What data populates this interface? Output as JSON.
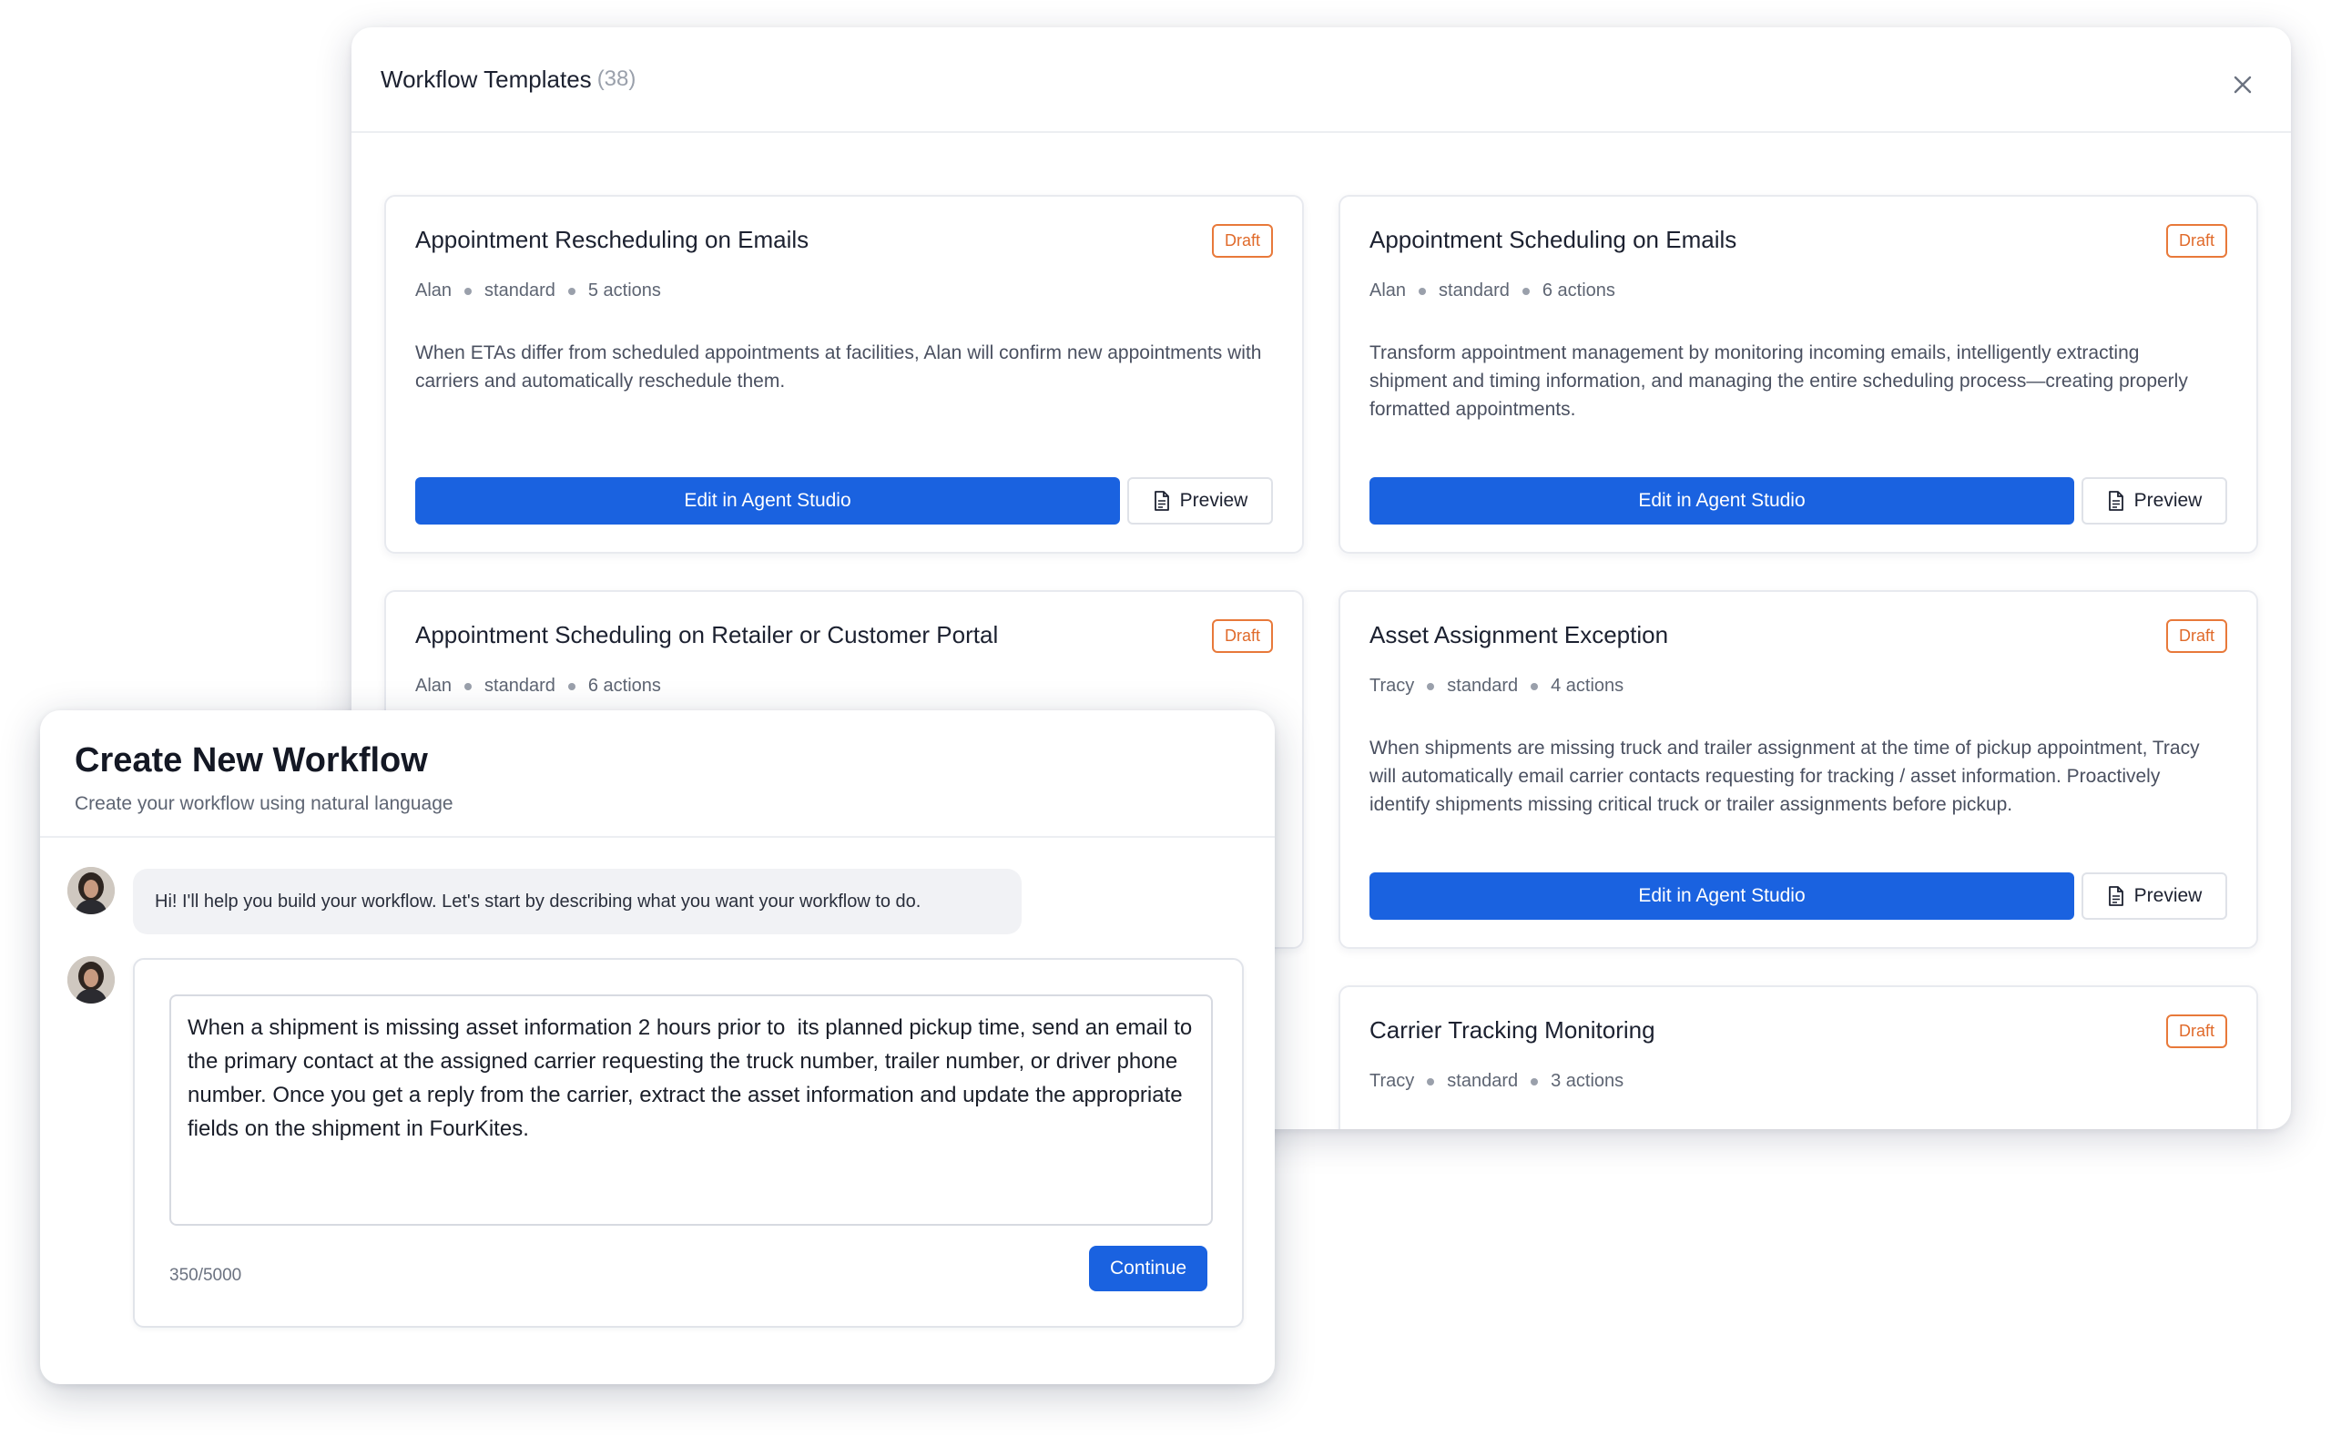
{
  "templates": {
    "title": "Workflow Templates",
    "count": "(38)",
    "cards": [
      {
        "title": "Appointment Rescheduling on Emails",
        "status": "Draft",
        "agent": "Alan",
        "type": "standard",
        "actions": "5 actions",
        "description": "When ETAs differ from scheduled appointments at facilities, Alan will confirm new appointments with carriers and automatically reschedule them.",
        "edit_label": "Edit in Agent Studio",
        "preview_label": "Preview"
      },
      {
        "title": "Appointment Scheduling on Emails",
        "status": "Draft",
        "agent": "Alan",
        "type": "standard",
        "actions": "6 actions",
        "description": "Transform appointment management by monitoring incoming emails, intelligently extracting shipment and timing information, and managing the entire scheduling process—creating properly formatted appointments.",
        "edit_label": "Edit in Agent Studio",
        "preview_label": "Preview"
      },
      {
        "title": "Appointment Scheduling on Retailer or Customer Portal",
        "status": "Draft",
        "agent": "Alan",
        "type": "standard",
        "actions": "6 actions"
      },
      {
        "title": "Asset Assignment Exception",
        "status": "Draft",
        "agent": "Tracy",
        "type": "standard",
        "actions": "4 actions",
        "description": "When shipments are missing truck and trailer assignment at the time of pickup appointment, Tracy will automatically email carrier contacts requesting for tracking / asset information. Proactively identify shipments missing critical truck or trailer assignments before pickup.",
        "edit_label": "Edit in Agent Studio",
        "preview_label": "Preview"
      },
      {
        "title": "Carrier Tracking Monitoring",
        "status": "Draft",
        "agent": "Tracy",
        "type": "standard",
        "actions": "3 actions"
      }
    ],
    "icons": {
      "close": "close-icon",
      "preview": "document-icon"
    }
  },
  "create": {
    "title": "Create New Workflow",
    "subtitle": "Create your workflow using natural language",
    "bot_message": "Hi! I'll help you build your workflow. Let's start by describing what you want your workflow to do.",
    "user_input": "When a shipment is missing asset information 2 hours prior to  its planned pickup time, send an email to the primary contact at the assigned carrier requesting the truck number, trailer number, or driver phone number. Once you get a reply from the carrier, extract the asset information and update the appropriate fields on the shipment in FourKites.",
    "char_count": "350/5000",
    "continue_label": "Continue"
  },
  "colors": {
    "primary": "#1a62e0",
    "draft_badge": "#e8793a"
  }
}
